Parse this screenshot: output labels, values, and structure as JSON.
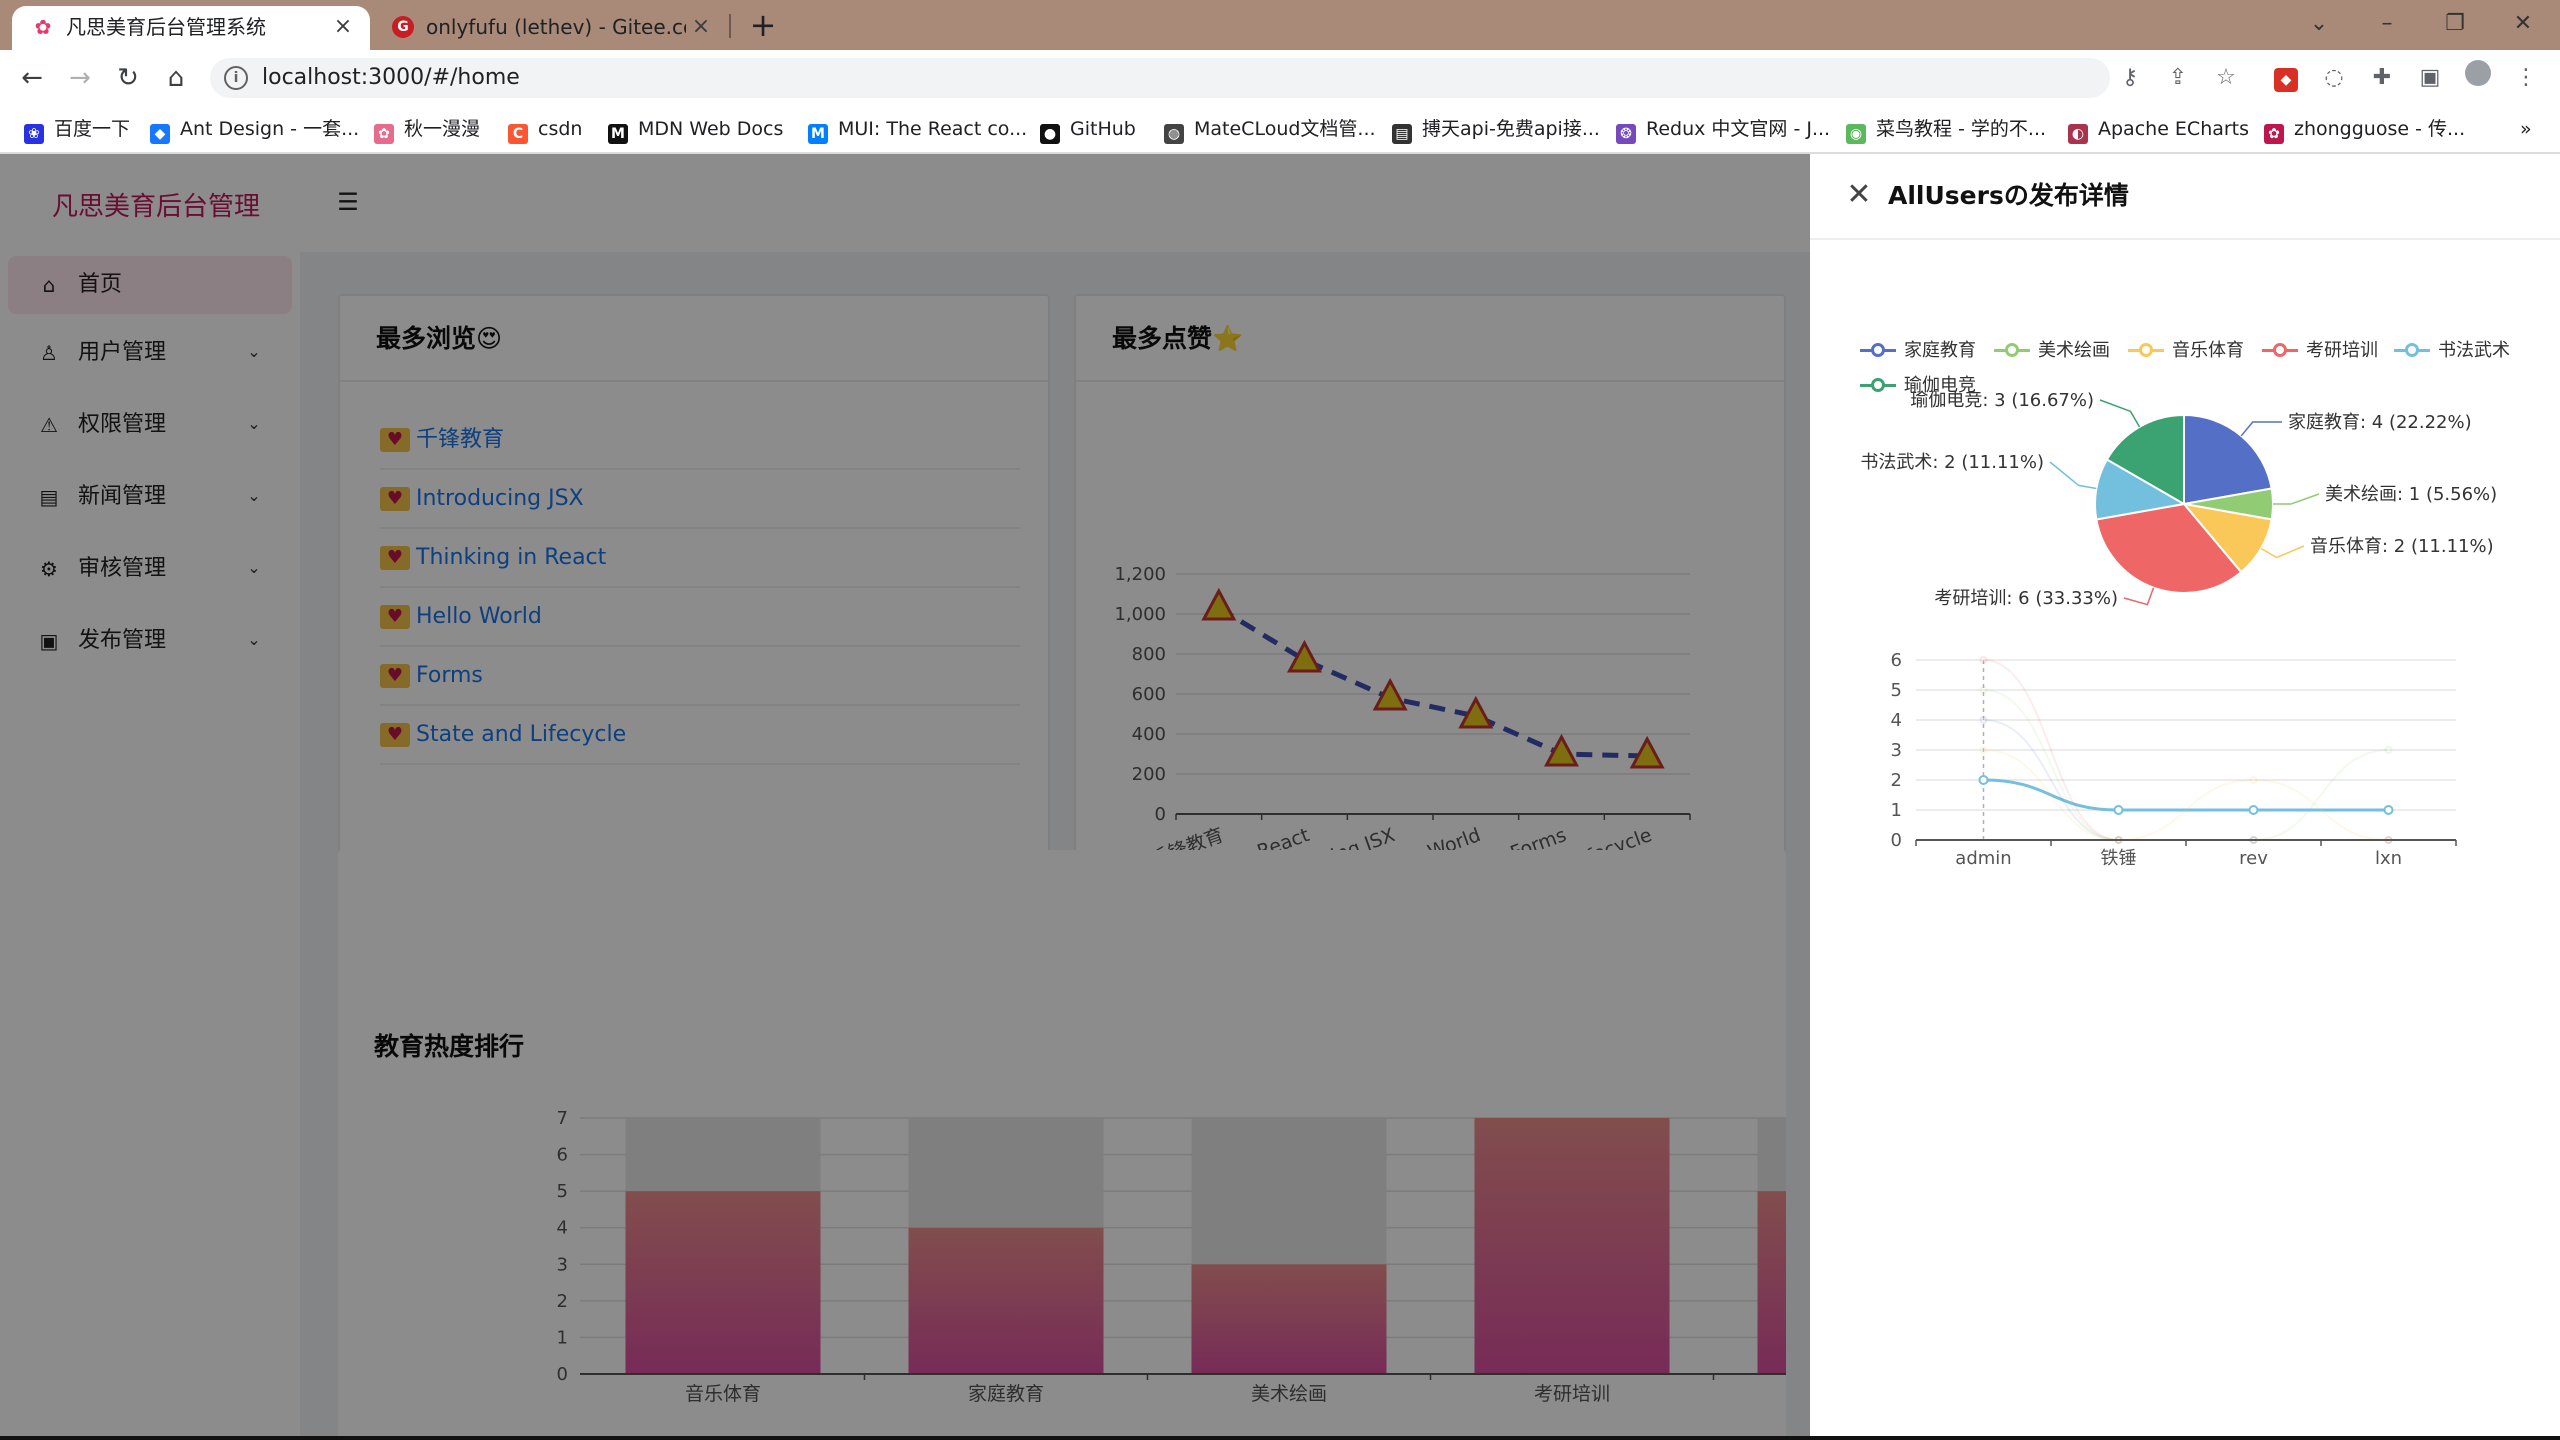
{
  "browser": {
    "tabs": [
      {
        "title": "凡思美育后台管理系统",
        "favicon": "flower-favicon",
        "active": true
      },
      {
        "title": "onlyfufu (lethev) - Gitee.com",
        "favicon": "gitee-favicon",
        "active": false
      }
    ],
    "url": "localhost:3000/#/home",
    "bookmarks": [
      {
        "label": "百度一下",
        "icon": "baidu-icon",
        "color": "#2932e1"
      },
      {
        "label": "Ant Design - 一套...",
        "icon": "antd-icon",
        "color": "#1677ff"
      },
      {
        "label": "秋一漫漫",
        "icon": "flower-icon",
        "color": "#e86a8f"
      },
      {
        "label": "csdn",
        "icon": "csdn-icon",
        "color": "#fc5531"
      },
      {
        "label": "MDN Web Docs",
        "icon": "mdn-icon",
        "color": "#111111"
      },
      {
        "label": "MUI: The React co...",
        "icon": "mui-icon",
        "color": "#007fff"
      },
      {
        "label": "GitHub",
        "icon": "github-icon",
        "color": "#111111"
      },
      {
        "label": "MateCLoud文档管...",
        "icon": "globe-icon",
        "color": "#444444"
      },
      {
        "label": "搏天api-免费api接...",
        "icon": "document-icon",
        "color": "#333333"
      },
      {
        "label": "Redux 中文官网 - J...",
        "icon": "redux-icon",
        "color": "#764abc"
      },
      {
        "label": "菜鸟教程 - 学的不...",
        "icon": "runoob-icon",
        "color": "#5cb85c"
      },
      {
        "label": "Apache ECharts",
        "icon": "echarts-icon",
        "color": "#aa344d"
      },
      {
        "label": "zhongguose - 传...",
        "icon": "flower-icon",
        "color": "#c0164e"
      }
    ],
    "more_bookmarks": "»"
  },
  "app": {
    "logo": "凡思美育后台管理",
    "menu": [
      {
        "label": "首页",
        "icon": "home-icon",
        "selected": true,
        "expandable": false
      },
      {
        "label": "用户管理",
        "icon": "user-icon",
        "selected": false,
        "expandable": true
      },
      {
        "label": "权限管理",
        "icon": "warning-icon",
        "selected": false,
        "expandable": true
      },
      {
        "label": "新闻管理",
        "icon": "news-icon",
        "selected": false,
        "expandable": true
      },
      {
        "label": "审核管理",
        "icon": "audit-icon",
        "selected": false,
        "expandable": true
      },
      {
        "label": "发布管理",
        "icon": "publish-icon",
        "selected": false,
        "expandable": true
      }
    ]
  },
  "cards": {
    "most_viewed": {
      "title": "最多浏览😍",
      "items": [
        "千锋教育",
        "Introducing JSX",
        "Thinking in React",
        "Hello World",
        "Forms",
        "State and Lifecycle"
      ]
    },
    "most_liked": {
      "title": "最多点赞⭐"
    },
    "ranking": {
      "title": "教育热度排行"
    }
  },
  "drawer": {
    "title": "AllUsersの发布详情",
    "close_icon": "close-icon"
  },
  "chart_data": [
    {
      "type": "line",
      "id": "likes-line",
      "categories": [
        "千锋教育",
        "Thinking in React",
        "Introducing JSX",
        "Hello World",
        "Forms",
        "State and Lifecycle"
      ],
      "values": [
        1030,
        770,
        580,
        490,
        300,
        290
      ],
      "ylim": [
        0,
        1200
      ],
      "yticks": [
        "0",
        "200",
        "400",
        "600",
        "800",
        "1,000",
        "1,200"
      ],
      "line_color": "#3f51b5",
      "marker": "triangle",
      "marker_color": "#e6c81e",
      "marker_stroke": "#c23531"
    },
    {
      "type": "bar",
      "id": "ranking-bar",
      "categories": [
        "音乐体育",
        "家庭教育",
        "美术绘画",
        "考研培训",
        ""
      ],
      "values": [
        5,
        4,
        3,
        7,
        5
      ],
      "ylim": [
        0,
        7
      ],
      "yticks": [
        "0",
        "1",
        "2",
        "3",
        "4",
        "5",
        "6",
        "7"
      ],
      "bar_gradient": [
        "#d94f9f",
        "#ec8e8c"
      ],
      "background_bar": true
    },
    {
      "type": "pie",
      "id": "publish-pie",
      "legend": [
        "家庭教育",
        "美术绘画",
        "音乐体育",
        "考研培训",
        "书法武术",
        "瑜伽电竞"
      ],
      "colors": [
        "#5470c6",
        "#91cc75",
        "#fac858",
        "#ee6666",
        "#73c0de",
        "#3ba272"
      ],
      "values": [
        4,
        1,
        2,
        6,
        2,
        3
      ],
      "labels": [
        "家庭教育: 4 (22.22%)",
        "美术绘画: 1 (5.56%)",
        "音乐体育: 2 (11.11%)",
        "考研培训: 6 (33.33%)",
        "书法武术: 2 (11.11%)",
        "瑜伽电竞: 3 (16.67%)"
      ]
    },
    {
      "type": "line",
      "id": "user-line",
      "categories": [
        "admin",
        "铁锤",
        "rev",
        "lxn"
      ],
      "series": [
        {
          "values": [
            2,
            1,
            1,
            1
          ],
          "color": "#73c0de",
          "emphasized": true
        },
        {
          "values": [
            4,
            0,
            0,
            0
          ],
          "color": "#5470c6",
          "emphasized": false
        },
        {
          "values": [
            6,
            0,
            0,
            0
          ],
          "color": "#ee6666",
          "emphasized": false
        },
        {
          "values": [
            3,
            0,
            2,
            0
          ],
          "color": "#fac858",
          "emphasized": false
        },
        {
          "values": [
            5,
            0,
            0,
            3
          ],
          "color": "#91cc75",
          "emphasized": false
        }
      ],
      "ylim": [
        0,
        6
      ],
      "yticks": [
        "0",
        "1",
        "2",
        "3",
        "4",
        "5",
        "6"
      ]
    }
  ]
}
